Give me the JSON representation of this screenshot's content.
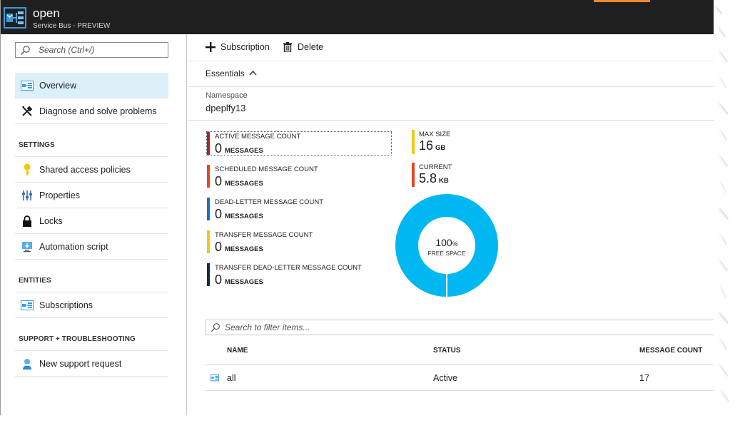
{
  "titlebar": {
    "title": "open",
    "subtitle": "Service Bus - PREVIEW",
    "icon": "service-bus-topic-icon",
    "accent_color": "#f28b30"
  },
  "leftnav": {
    "search_placeholder": "Search (Ctrl+/)",
    "items_top": [
      {
        "label": "Overview",
        "icon": "overview-icon",
        "active": true
      },
      {
        "label": "Diagnose and solve problems",
        "icon": "wrench-icon"
      }
    ],
    "settings_header": "SETTINGS",
    "settings_items": [
      {
        "label": "Shared access policies",
        "icon": "key-icon"
      },
      {
        "label": "Properties",
        "icon": "sliders-icon"
      },
      {
        "label": "Locks",
        "icon": "lock-icon"
      },
      {
        "label": "Automation script",
        "icon": "monitor-download-icon"
      }
    ],
    "entities_header": "ENTITIES",
    "entities_items": [
      {
        "label": "Subscriptions",
        "icon": "subscriptions-icon"
      }
    ],
    "support_header": "SUPPORT + TROUBLESHOOTING",
    "support_items": [
      {
        "label": "New support request",
        "icon": "support-person-icon"
      }
    ]
  },
  "toolbar": {
    "subscription_label": "Subscription",
    "delete_label": "Delete"
  },
  "essentials": {
    "label": "Essentials",
    "namespace_label": "Namespace",
    "namespace_value": "dpeplfy13"
  },
  "metrics": [
    {
      "label": "ACTIVE MESSAGE COUNT",
      "value": "0",
      "unit": "MESSAGES",
      "color": "#a4262c"
    },
    {
      "label": "SCHEDULED MESSAGE COUNT",
      "value": "0",
      "unit": "MESSAGES",
      "color": "#e8461e"
    },
    {
      "label": "DEAD-LETTER MESSAGE COUNT",
      "value": "0",
      "unit": "MESSAGES",
      "color": "#1e6fc4"
    },
    {
      "label": "TRANSFER MESSAGE COUNT",
      "value": "0",
      "unit": "MESSAGES",
      "color": "#f2c811"
    },
    {
      "label": "TRANSFER DEAD-LETTER MESSAGE COUNT",
      "value": "0",
      "unit": "MESSAGES",
      "color": "#142850"
    }
  ],
  "size": {
    "max_label": "MAX SIZE",
    "max_value": "16",
    "max_unit": "GB",
    "max_color": "#f2c811",
    "current_label": "CURRENT",
    "current_value": "5.8",
    "current_unit": "KB",
    "current_color": "#e8461e"
  },
  "donut": {
    "percent": "100",
    "percent_symbol": "%",
    "caption": "FREE SPACE",
    "fraction_free": 1.0,
    "color": "#00b7f1"
  },
  "filter": {
    "placeholder": "Search to filter items..."
  },
  "table": {
    "columns": [
      "NAME",
      "STATUS",
      "MESSAGE COUNT"
    ],
    "rows": [
      {
        "name": "all",
        "status": "Active",
        "message_count": "17",
        "icon": "subscription-icon"
      }
    ]
  }
}
